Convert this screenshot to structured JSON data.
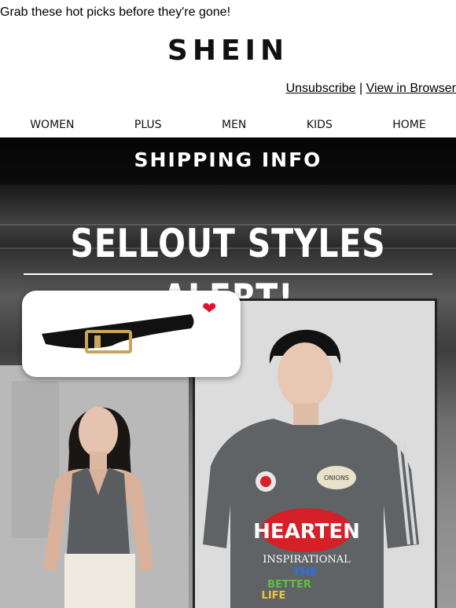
{
  "preheader": "Grab these hot picks before they're gone!",
  "brand": "SHEIN",
  "header_links": {
    "unsubscribe": "Unsubscribe",
    "separator": "|",
    "view_browser": "View in Browser"
  },
  "nav": [
    "WOMEN",
    "PLUS",
    "MEN",
    "KIDS",
    "HOME"
  ],
  "hero": {
    "shipping_label": "SHIPPING INFO",
    "headline": "SELLOUT STYLES ALERT!",
    "tshirt_text": {
      "badge": "ONIONS",
      "logo": "HEARTEN",
      "line1": "INSPIRATIONAL",
      "line2": "THE",
      "line3": "BETTER",
      "line4": "LIFE"
    }
  },
  "colors": {
    "heart": "#e3102b",
    "tshirt": "#5f6365"
  }
}
